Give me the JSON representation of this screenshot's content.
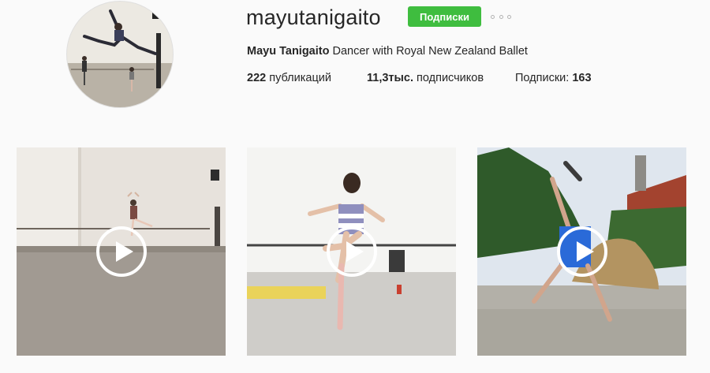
{
  "profile": {
    "username": "mayutanigaito",
    "follow_label": "Подписки",
    "full_name": "Mayu Tanigaito",
    "bio": "Dancer with Royal New Zealand Ballet",
    "stats": {
      "posts_count": "222",
      "posts_label": "публикаций",
      "followers_count": "11,3тыс.",
      "followers_label": "подписчиков",
      "following_label": "Подписки:",
      "following_count": "163"
    }
  },
  "posts": [
    {
      "type": "video",
      "icon": "play-icon",
      "scene": "dancer in studio at barre"
    },
    {
      "type": "video",
      "icon": "play-icon",
      "scene": "dancer on pointe in studio"
    },
    {
      "type": "video",
      "icon": "play-icon",
      "scene": "dancer outdoors in garden"
    }
  ],
  "colors": {
    "follow_button": "#3fbd3f",
    "background": "#fafafa",
    "text": "#262626"
  }
}
